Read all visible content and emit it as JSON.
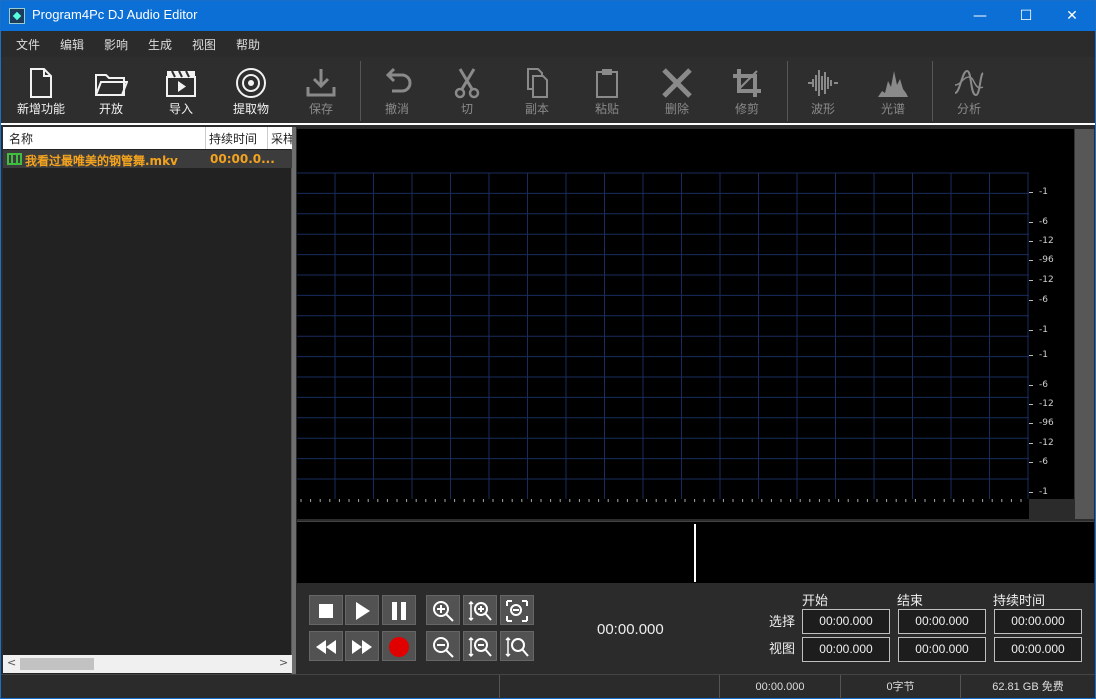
{
  "window": {
    "title": "Program4Pc DJ Audio Editor",
    "minimize": "—",
    "maximize": "☐",
    "close": "✕"
  },
  "menu": [
    "文件",
    "编辑",
    "影响",
    "生成",
    "视图",
    "帮助"
  ],
  "toolbar": {
    "new": "新增功能",
    "open": "开放",
    "import": "导入",
    "extract": "提取物",
    "save": "保存",
    "undo": "撤消",
    "cut": "切",
    "copy": "副本",
    "paste": "粘贴",
    "delete": "删除",
    "trim": "修剪",
    "waveform": "波形",
    "spectrum": "光谱",
    "analysis": "分析"
  },
  "file_list": {
    "columns": [
      "名称",
      "持续时间",
      "采样"
    ],
    "rows": [
      {
        "name": "我看过最唯美的钢管舞.mkv",
        "duration": "00:00.0..."
      }
    ]
  },
  "db_scale": [
    "-1",
    "-6",
    "-12",
    "-96",
    "-12",
    "-6",
    "-1",
    "-1",
    "-6",
    "-12",
    "-96",
    "-12",
    "-6",
    "-1"
  ],
  "transport": {
    "position": "00:00.000",
    "headers": {
      "start": "开始",
      "end": "结束",
      "duration": "持续时间"
    },
    "rows": {
      "selection": "选择",
      "view": "视图"
    },
    "selection": {
      "start": "00:00.000",
      "end": "00:00.000",
      "duration": "00:00.000"
    },
    "view": {
      "start": "00:00.000",
      "end": "00:00.000",
      "duration": "00:00.000"
    }
  },
  "status": {
    "time": "00:00.000",
    "bytes": "0字节",
    "free": "62.81 GB 免费"
  },
  "colors": {
    "titlebar": "#0b6fd6",
    "file_name": "#f4a31e",
    "record": "#e00000",
    "grid": "#1a2c5e"
  }
}
